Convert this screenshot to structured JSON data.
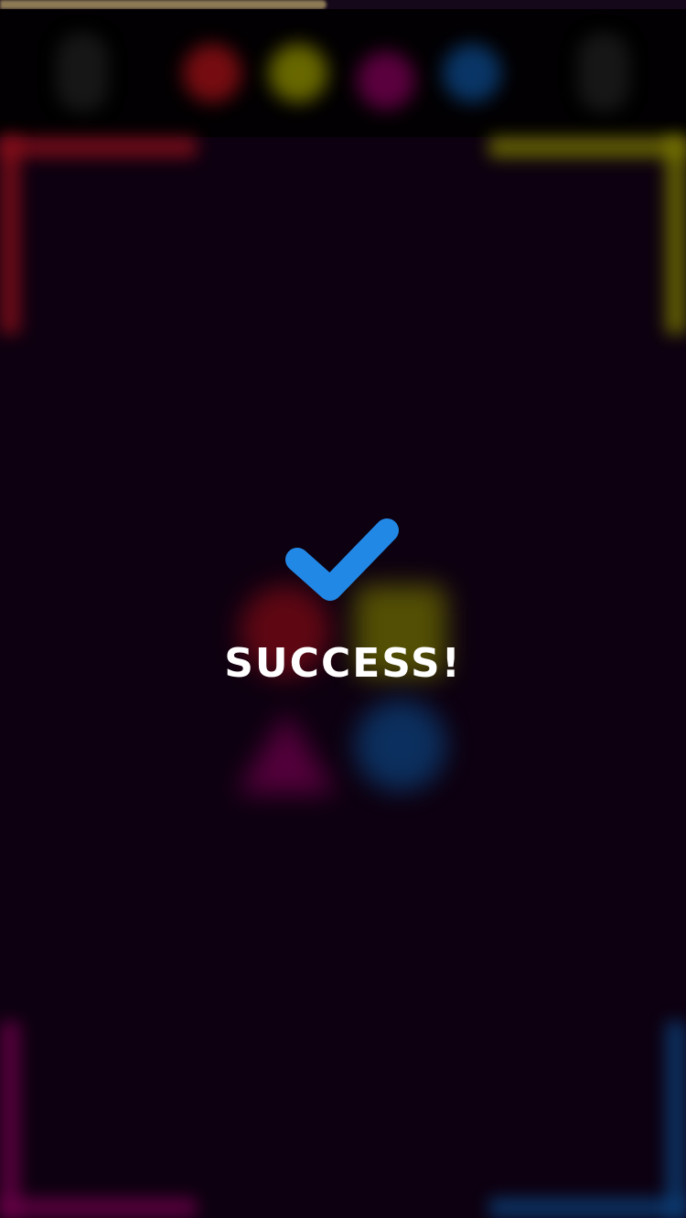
{
  "progress": {
    "fraction": 0.476,
    "color": "#8d7a55"
  },
  "top_bar": {
    "background": "#020002",
    "color_dots": [
      {
        "name": "red-dot",
        "color": "#8b0f14"
      },
      {
        "name": "yellow-dot",
        "color": "#7a7a00"
      },
      {
        "name": "magenta-dot",
        "color": "#6b0049"
      },
      {
        "name": "blue-dot",
        "color": "#0b3f78"
      }
    ],
    "left_button_icon": "menu-button-icon",
    "right_button_icon": "settings-button-icon"
  },
  "corners": {
    "top_left": "#8b0f1a",
    "top_right": "#7a7a00",
    "bottom_left": "#6b0049",
    "bottom_right": "#0b3f78"
  },
  "board_shapes": [
    {
      "name": "red-circle-shape",
      "shape": "circle",
      "color": "#7a0a14"
    },
    {
      "name": "yellow-square-shape",
      "shape": "square",
      "color": "#6b6a00"
    },
    {
      "name": "magenta-triangle-shape",
      "shape": "triangle",
      "color": "#6b0049"
    },
    {
      "name": "blue-circle-shape",
      "shape": "circle",
      "color": "#0b3f78"
    }
  ],
  "result": {
    "icon": "checkmark-icon",
    "icon_color": "#2288e6",
    "message": "SUCCESS!"
  }
}
